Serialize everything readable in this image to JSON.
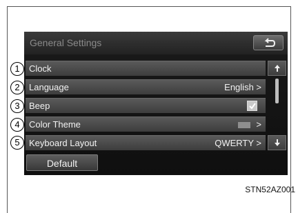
{
  "screen": {
    "title": "General Settings",
    "back_icon": "back-arrow-icon",
    "rows": [
      {
        "label": "Clock",
        "value": ""
      },
      {
        "label": "Language",
        "value": "English >"
      },
      {
        "label": "Beep",
        "value": "",
        "checked": true
      },
      {
        "label": "Color Theme",
        "value": ">"
      },
      {
        "label": "Keyboard Layout",
        "value": "QWERTY >"
      }
    ],
    "default_label": "Default",
    "scroll_up_icon": "scroll-up-icon",
    "scroll_down_icon": "scroll-down-icon"
  },
  "callouts": [
    "1",
    "2",
    "3",
    "4",
    "5"
  ],
  "caption": "STN52AZ001",
  "colors": {
    "screen_bg": "#141414",
    "row_bg": "#4a4a4a",
    "text": "#f2f2f2",
    "header_text": "#8a8a8a"
  }
}
